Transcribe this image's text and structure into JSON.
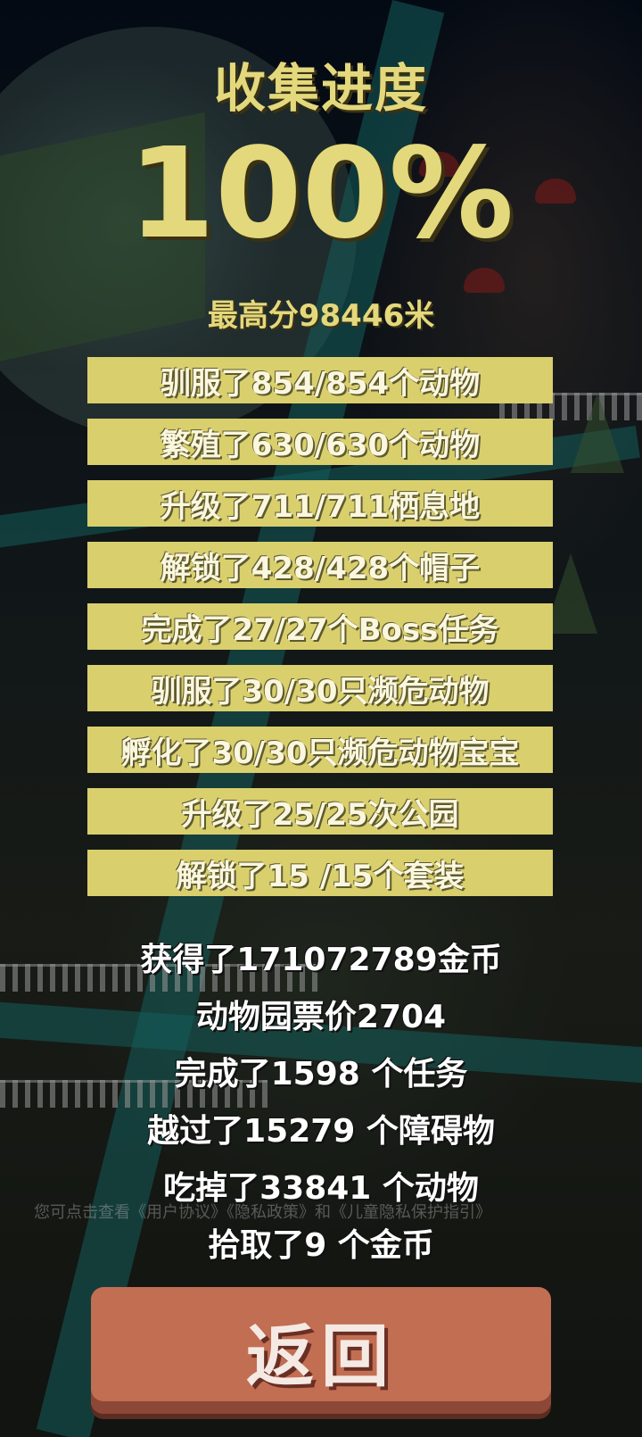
{
  "header": {
    "title": "收集进度",
    "percent": "100%",
    "high_score": "最高分98446米"
  },
  "bars": [
    "驯服了854/854个动物",
    "繁殖了630/630个动物",
    "升级了711/711栖息地",
    "解锁了428/428个帽子",
    "完成了27/27个Boss任务",
    "驯服了30/30只濒危动物",
    "孵化了30/30只濒危动物宝宝",
    "升级了25/25次公园",
    "解锁了15 /15个套装"
  ],
  "stats": [
    "获得了171072789金币",
    "动物园票价2704",
    "完成了1598 个任务",
    "越过了15279 个障碍物",
    "吃掉了33841 个动物",
    "拾取了9 个金币"
  ],
  "privacy_note": "您可点击查看《用户协议》《隐私政策》和《儿童隐私保护指引》",
  "back_button": "返回"
}
